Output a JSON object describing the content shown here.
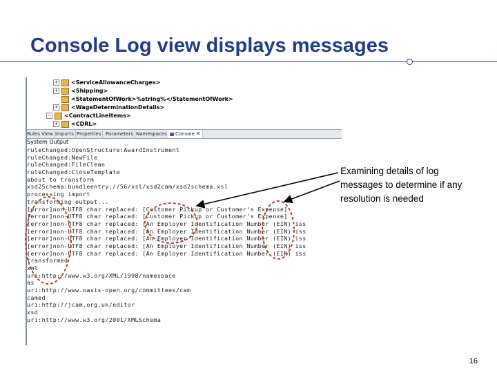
{
  "slide": {
    "title": "Console Log view displays messages",
    "page_number": "16",
    "callout_text": "Examining details of log messages to determine if any resolution is needed"
  },
  "tree": {
    "rows": [
      {
        "label": "<ServiceAllowanceCharges>",
        "expandable": true
      },
      {
        "label": "<Shipping>",
        "expandable": true
      },
      {
        "label": "<StatementOfWork>%string%</StatementOfWork>",
        "expandable": false
      },
      {
        "label": "<WageDeterminationDetails>",
        "expandable": true
      },
      {
        "label": "<ContractLineItems>",
        "expandable": true
      },
      {
        "label": "<CDRL>",
        "expandable": true
      }
    ]
  },
  "tabs": [
    {
      "label": "Rules View"
    },
    {
      "label": "Imports"
    },
    {
      "label": "Properties"
    },
    {
      "label": "Parameters"
    },
    {
      "label": "Namespaces"
    },
    {
      "label": "Console",
      "active": true,
      "close": "✕"
    }
  ],
  "console": {
    "header": "System Output",
    "lines": [
      "ruleChanged:OpenStructure:AwardInstrument",
      "ruleChanged:NewFile",
      "ruleChanged:FileClean",
      "ruleChanged:CloseTemplate",
      "about to transform",
      "xsd2Schema:bundleentry://56/xsl/xsd2cam/xsd2schema.xsl",
      "processing import",
      "transforming output...",
      "[error]non-UTF8 char replaced: [Customer Pickup or Customer's Expense]",
      "[error]non-UTF8 char replaced: [Customer Pickup or Customer's Expense]",
      "[error]non-UTF8 char replaced: [An Employer Identification Number (EIN) iss",
      "[error]non-UTF8 char replaced: [An Employer Identification Number (EIN) iss",
      "[error]non-UTF8 char replaced: [An Employer Identification Number (EIN) iss",
      "[error]non-UTF8 char replaced: [An Employer Identification Number (EIN) iss",
      "[error]non-UTF8 char replaced: [An Employer Identification Number (EIN) iss",
      "transformed",
      "xml",
      "uri:http://www.w3.org/XML/1998/namespace",
      "as",
      "uri:http://www.oasis-open.org/committees/cam",
      "camed",
      "uri:http://jcam.org.uk/editor",
      "xsd",
      "uri:http://www.w3.org/2001/XMLSchema"
    ]
  },
  "colors": {
    "title": "#1f3c8a",
    "annotation_red": "#c0392b",
    "arrow": "#000000"
  }
}
